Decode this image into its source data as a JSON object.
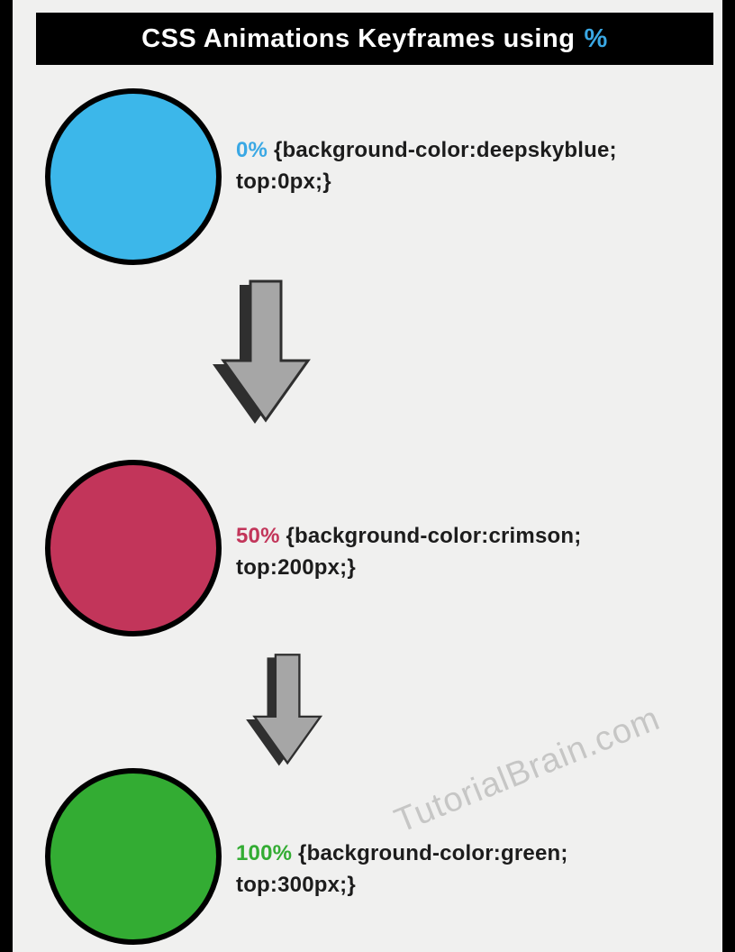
{
  "title": {
    "text": "CSS Animations Keyframes using",
    "symbol": "%"
  },
  "keyframes": [
    {
      "percent": "0%",
      "line1_rest": " {background-color:deepskyblue;",
      "line2": " top:0px;}",
      "circle_color": "#3cb7ea",
      "pct_class": "pct-blue"
    },
    {
      "percent": "50%",
      "line1_rest": " {background-color:crimson;",
      "line2": " top:200px;}",
      "circle_color": "#c2355a",
      "pct_class": "pct-crimson"
    },
    {
      "percent": "100%",
      "line1_rest": " {background-color:green;",
      "line2": " top:300px;}",
      "circle_color": "#33ac33",
      "pct_class": "pct-green"
    }
  ],
  "watermark": "TutorialBrain.com"
}
